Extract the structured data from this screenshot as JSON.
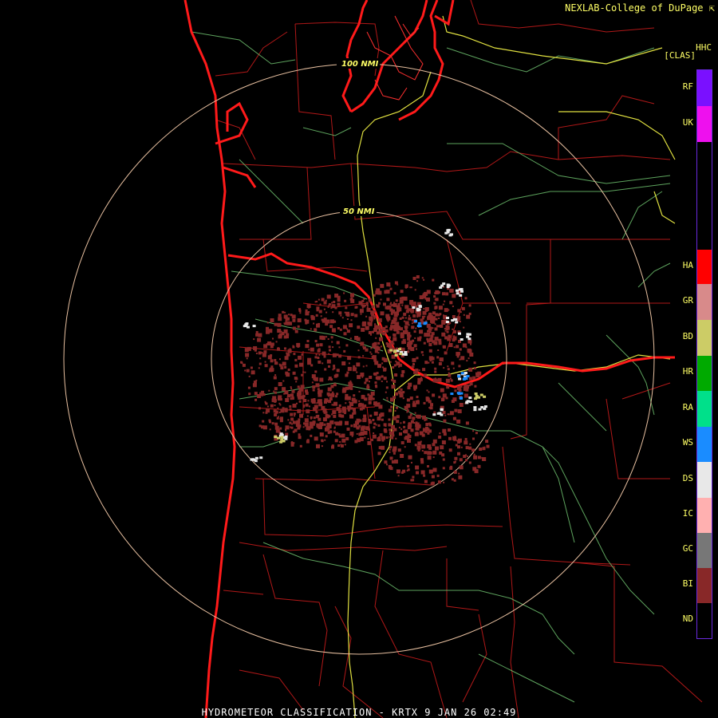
{
  "header": {
    "credit": "NEXLAB-College of DuPage",
    "credit_icon": "arrow-icon",
    "product_code": "HHC",
    "product_unit": "[CLAS]",
    "unit_suffix": ""
  },
  "map": {
    "ring_labels": [
      "100 NMI",
      "50 NMI"
    ]
  },
  "legend": {
    "items": [
      {
        "code": "RF",
        "color": "#7a10ff"
      },
      {
        "code": "UK",
        "color": "#ee10ee"
      },
      {
        "code": "HA",
        "color": "#ff0000"
      },
      {
        "code": "GR",
        "color": "#d88a8a"
      },
      {
        "code": "BD",
        "color": "#cccc66"
      },
      {
        "code": "HR",
        "color": "#00aa00"
      },
      {
        "code": "RA",
        "color": "#00e08a"
      },
      {
        "code": "WS",
        "color": "#1a8cff"
      },
      {
        "code": "DS",
        "color": "#e8e8e8"
      },
      {
        "code": "IC",
        "color": "#ffb0b0"
      },
      {
        "code": "GC",
        "color": "#777777"
      },
      {
        "code": "BI",
        "color": "#882828"
      },
      {
        "code": "ND",
        "color": "#000000"
      }
    ]
  },
  "footer": {
    "title": "HYDROMETEOR CLASSIFICATION - KRTX 9 JAN 26 02:49"
  }
}
